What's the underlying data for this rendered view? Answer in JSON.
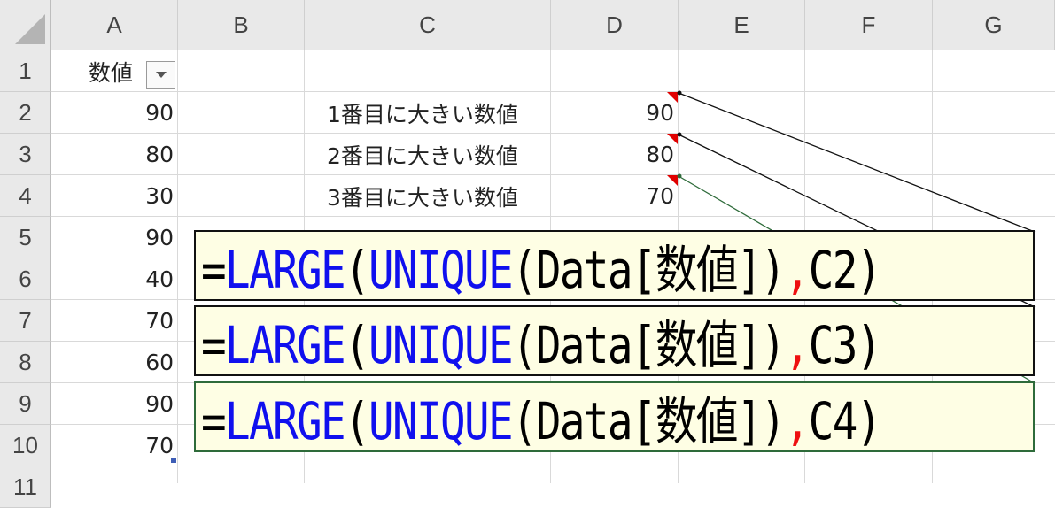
{
  "columns": [
    "A",
    "B",
    "C",
    "D",
    "E",
    "F",
    "G"
  ],
  "rows": [
    "1",
    "2",
    "3",
    "4",
    "5",
    "6",
    "7",
    "8",
    "9",
    "10",
    "11"
  ],
  "header_cell": "数値",
  "column_a_values": [
    "90",
    "80",
    "30",
    "90",
    "40",
    "70",
    "60",
    "90",
    "70"
  ],
  "labels": [
    "1番目に大きい数値",
    "2番目に大きい数値",
    "3番目に大きい数値"
  ],
  "results": [
    "90",
    "80",
    "70"
  ],
  "formulas": [
    {
      "eq": "=",
      "fn1": "LARGE",
      "p1": "(",
      "fn2": "UNIQUE",
      "rest": "(Data[数値])",
      "comma": ",",
      "ref": "C2",
      "close": ")"
    },
    {
      "eq": "=",
      "fn1": "LARGE",
      "p1": "(",
      "fn2": "UNIQUE",
      "rest": "(Data[数値])",
      "comma": ",",
      "ref": "C3",
      "close": ")"
    },
    {
      "eq": "=",
      "fn1": "LARGE",
      "p1": "(",
      "fn2": "UNIQUE",
      "rest": "(Data[数値])",
      "comma": ",",
      "ref": "C4",
      "close": ")"
    }
  ],
  "colors": {
    "function": "#1010ee",
    "comma": "#ee1010",
    "note_marker": "#e00000",
    "callout_fill": "#fefee4",
    "callout_border_green": "#2e6b3a"
  }
}
